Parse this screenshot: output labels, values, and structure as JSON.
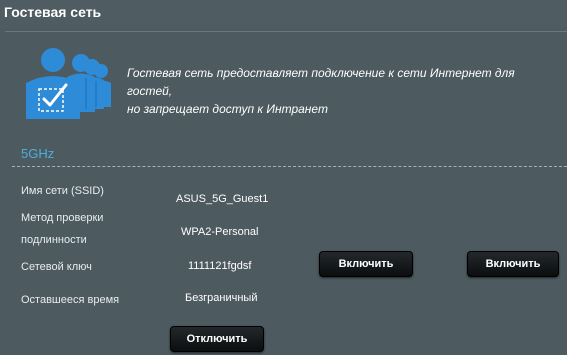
{
  "header": {
    "title": "Гостевая сеть"
  },
  "intro": {
    "icon": "guest-users-icon",
    "description_line1": "Гостевая сеть предоставляет подключение к сети Интернет для гостей,",
    "description_line2": "но запрещает доступ к Интранет"
  },
  "band": {
    "label": "5GHz"
  },
  "fields": {
    "ssid_label": "Имя сети (SSID)",
    "ssid_value": "ASUS_5G_Guest1",
    "auth_label_line1": "Метод проверки",
    "auth_label_line2": "подлинности",
    "auth_value": "WPA2-Personal",
    "key_label": "Сетевой ключ",
    "key_value": "1111121fgdsf",
    "time_label": "Оставшееся время",
    "time_value": "Безграничный"
  },
  "buttons": {
    "enable_1": "Включить",
    "enable_2": "Включить",
    "disable": "Отключить"
  },
  "colors": {
    "background": "#4d5a60",
    "band_accent": "#4ab0e0",
    "icon_blue": "#2e8bd8"
  }
}
